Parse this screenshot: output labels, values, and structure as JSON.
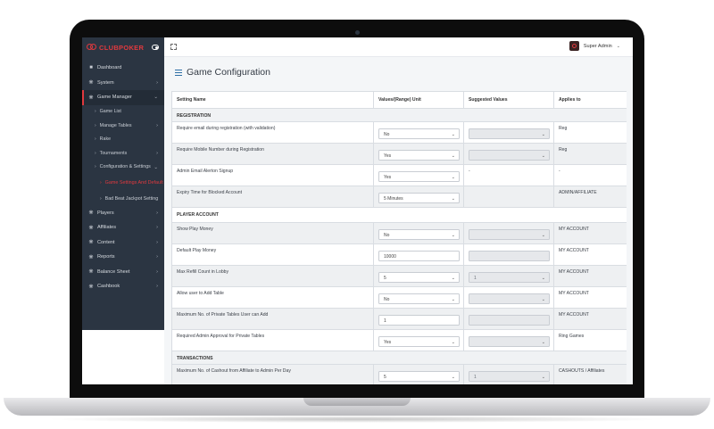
{
  "brand": {
    "name": "CLUBPOKER",
    "accent": "#e0393e",
    "sidebar_bg": "#2b3542"
  },
  "topbar": {
    "user_name": "Super Admin"
  },
  "sidebar": {
    "items": [
      {
        "label": "Dashboard",
        "icon": "dashboard-icon"
      },
      {
        "label": "System",
        "icon": "gear-icon"
      },
      {
        "label": "Game Manager",
        "icon": "gear-icon"
      },
      {
        "label": "Players",
        "icon": "gear-icon"
      },
      {
        "label": "Affiliates",
        "icon": "gear-icon"
      },
      {
        "label": "Content",
        "icon": "gear-icon"
      },
      {
        "label": "Reports",
        "icon": "gear-icon"
      },
      {
        "label": "Balance Sheet",
        "icon": "gear-icon"
      },
      {
        "label": "Cashbook",
        "icon": "gear-icon"
      }
    ],
    "sub_items": {
      "game_list": "Game List",
      "manage_tables": "Manage Tables",
      "rake": "Rake",
      "tournaments": "Tournaments",
      "config_settings": "Configuration & Settings",
      "game_settings_default": "Game Settings And Default",
      "bad_beat": "Bad Beat Jackpot Setting"
    }
  },
  "page": {
    "title": "Game Configuration"
  },
  "table": {
    "headers": [
      "Setting Name",
      "Values/(Range) Unit",
      "Suggested Values",
      "Applies to"
    ],
    "sections": {
      "registration": "REGISTRATION",
      "player_account": "PLAYER ACCOUNT",
      "transactions": "TRANSACTIONS"
    },
    "rows": [
      {
        "name": "Require email during registration (with validation)",
        "value": "No",
        "suggested": "",
        "applies": "Reg"
      },
      {
        "name": "Require Mobile Number during Registration",
        "value": "Yes",
        "suggested": "",
        "applies": "Reg"
      },
      {
        "name": "Admin Email Alerton Signup",
        "value": "Yes",
        "suggested": "-",
        "applies": "-"
      },
      {
        "name": "Expiry Time for Blocked Account",
        "value": "5 Minutes",
        "suggested": "",
        "applies": "ADMIN/AFFILIATE"
      },
      {
        "name": "Show Play Money",
        "value": "No",
        "suggested": "",
        "applies": "MY ACCOUNT"
      },
      {
        "name": "Default Play Money",
        "value": "10000",
        "suggested": "",
        "applies": "MY ACCOUNT"
      },
      {
        "name": "Max Refill Count in Lobby",
        "value": "5",
        "suggested": "1",
        "applies": "MY ACCOUNT"
      },
      {
        "name": "Allow user to Add Table",
        "value": "No",
        "suggested": "",
        "applies": "MY ACCOUNT"
      },
      {
        "name": "Maximum No. of Private Tables User can Add",
        "value": "1",
        "suggested": "",
        "applies": "MY ACCOUNT"
      },
      {
        "name": "Required Admin Approval for Private Tables",
        "value": "Yes",
        "suggested": "",
        "applies": "Ring Games"
      },
      {
        "name": "Maximum No. of Cashout from Affiliate to Admin Per Day",
        "value": "5",
        "suggested": "1",
        "applies": "CASHOUTS / Affiliates"
      }
    ]
  }
}
